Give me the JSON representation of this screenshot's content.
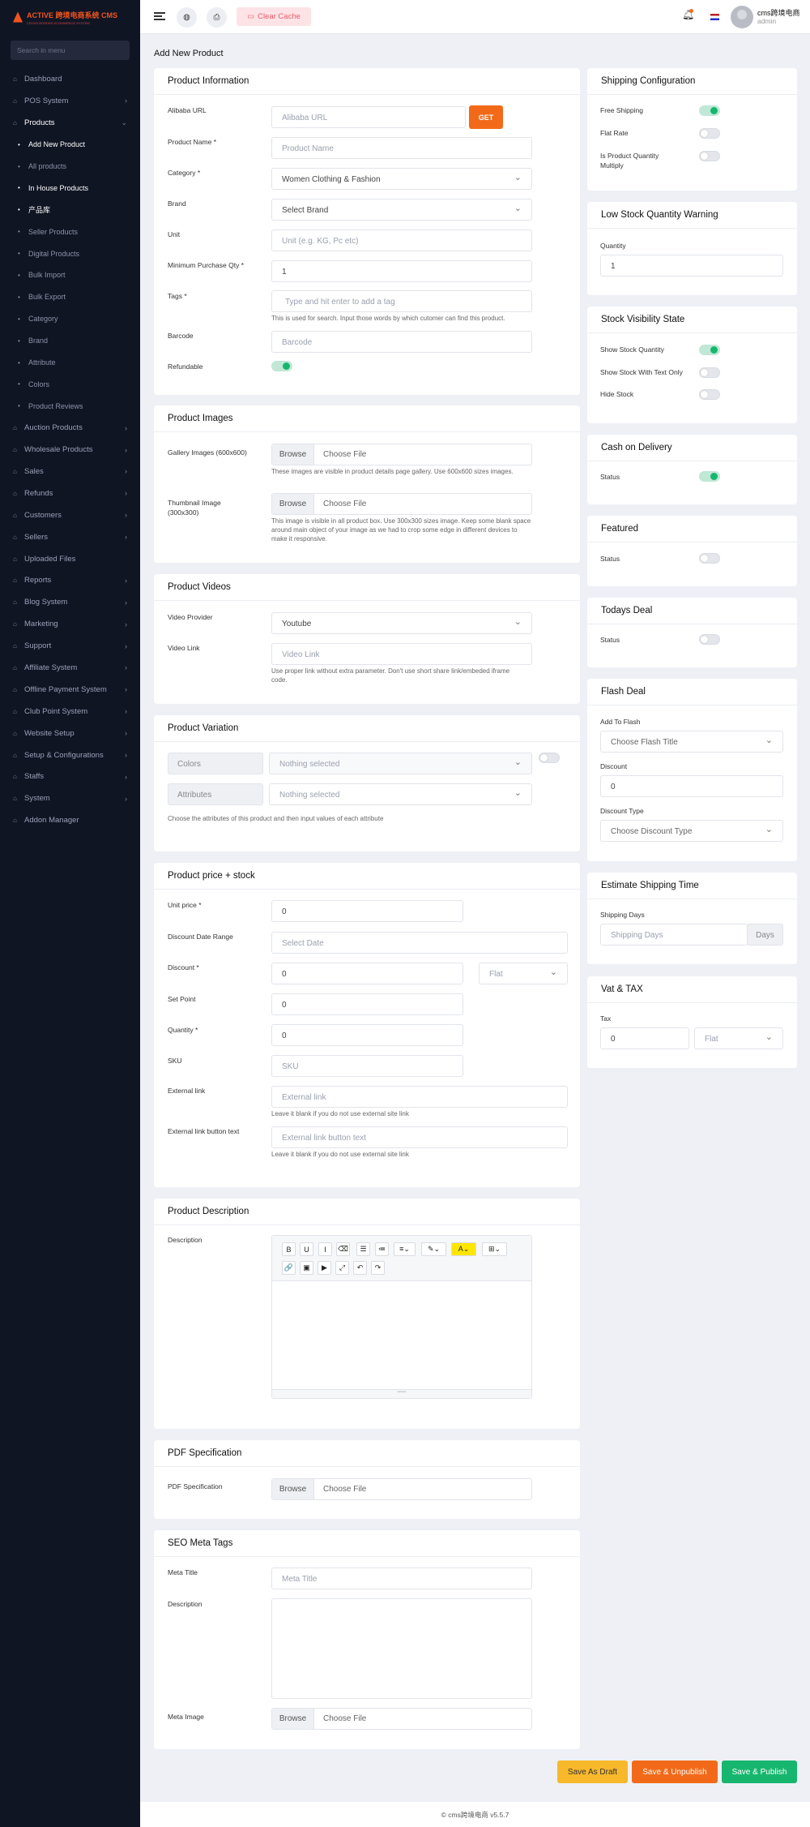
{
  "brand": {
    "name": "ACTIVE 跨境电商系统 CMS",
    "sub": "CROSS BORDER ECOMMERCE SYSTEM"
  },
  "sidebar": {
    "search_placeholder": "Search in menu",
    "items": [
      {
        "label": "Dashboard",
        "icon": "home-icon"
      },
      {
        "label": "POS System",
        "icon": "pos-icon",
        "chev": true
      },
      {
        "label": "Products",
        "icon": "product-icon",
        "chev": true,
        "open": true
      },
      {
        "label": "Add New Product",
        "sub": true,
        "cur": true
      },
      {
        "label": "All products",
        "sub": true
      },
      {
        "label": "In House Products",
        "sub": true,
        "cur": true
      },
      {
        "label": "产品库",
        "sub": true,
        "cur": true
      },
      {
        "label": "Seller Products",
        "sub": true
      },
      {
        "label": "Digital Products",
        "sub": true
      },
      {
        "label": "Bulk Import",
        "sub": true
      },
      {
        "label": "Bulk Export",
        "sub": true
      },
      {
        "label": "Category",
        "sub": true
      },
      {
        "label": "Brand",
        "sub": true
      },
      {
        "label": "Attribute",
        "sub": true
      },
      {
        "label": "Colors",
        "sub": true
      },
      {
        "label": "Product Reviews",
        "sub": true
      },
      {
        "label": "Auction Products",
        "icon": "auction-icon",
        "chev": true
      },
      {
        "label": "Wholesale Products",
        "icon": "wholesale-icon",
        "chev": true
      },
      {
        "label": "Sales",
        "icon": "sales-icon",
        "chev": true
      },
      {
        "label": "Refunds",
        "icon": "refund-icon",
        "chev": true
      },
      {
        "label": "Customers",
        "icon": "customers-icon",
        "chev": true
      },
      {
        "label": "Sellers",
        "icon": "sellers-icon",
        "chev": true
      },
      {
        "label": "Uploaded Files",
        "icon": "files-icon"
      },
      {
        "label": "Reports",
        "icon": "reports-icon",
        "chev": true
      },
      {
        "label": "Blog System",
        "icon": "blog-icon",
        "chev": true
      },
      {
        "label": "Marketing",
        "icon": "marketing-icon",
        "chev": true
      },
      {
        "label": "Support",
        "icon": "support-icon",
        "chev": true
      },
      {
        "label": "Affiliate System",
        "icon": "affiliate-icon",
        "chev": true
      },
      {
        "label": "Offline Payment System",
        "icon": "payment-icon",
        "chev": true
      },
      {
        "label": "Club Point System",
        "icon": "club-icon",
        "chev": true
      },
      {
        "label": "Website Setup",
        "icon": "website-icon",
        "chev": true
      },
      {
        "label": "Setup & Configurations",
        "icon": "setup-icon",
        "chev": true
      },
      {
        "label": "Staffs",
        "icon": "staff-icon",
        "chev": true
      },
      {
        "label": "System",
        "icon": "system-icon",
        "chev": true
      },
      {
        "label": "Addon Manager",
        "icon": "addon-icon"
      }
    ]
  },
  "topbar": {
    "clear_cache": "Clear Cache",
    "user_name": "cms跨境电商",
    "user_role": "admin"
  },
  "page_title": "Add New Product",
  "product_info": {
    "title": "Product Information",
    "alibaba_label": "Alibaba URL",
    "alibaba_ph": "Alibaba URL",
    "get": "GET",
    "name_label": "Product Name *",
    "name_ph": "Product Name",
    "category_label": "Category *",
    "category_val": "Women Clothing & Fashion",
    "brand_label": "Brand",
    "brand_val": "Select Brand",
    "unit_label": "Unit",
    "unit_ph": "Unit (e.g. KG, Pc etc)",
    "minqty_label": "Minimum Purchase Qty *",
    "minqty_val": "1",
    "tags_label": "Tags *",
    "tags_ph": "Type and hit enter to add a tag",
    "tags_help": "This is used for search. Input those words by which cutomer can find this product.",
    "barcode_label": "Barcode",
    "barcode_ph": "Barcode",
    "refundable_label": "Refundable",
    "refundable_on": true
  },
  "images": {
    "title": "Product Images",
    "gallery_label": "Gallery Images (600x600)",
    "browse": "Browse",
    "choose": "Choose File",
    "gallery_help": "These images are visible in product details page gallery. Use 600x600 sizes images.",
    "thumb_label": "Thumbnail Image (300x300)",
    "thumb_help": "This image is visible in all product box. Use 300x300 sizes image. Keep some blank space around main object of your image as we had to crop some edge in different devices to make it responsive."
  },
  "videos": {
    "title": "Product Videos",
    "provider_label": "Video Provider",
    "provider_val": "Youtube",
    "link_label": "Video Link",
    "link_ph": "Video Link",
    "link_help": "Use proper link without extra parameter. Don't use short share link/embeded iframe code."
  },
  "variation": {
    "title": "Product Variation",
    "colors": "Colors",
    "attributes": "Attributes",
    "nothing": "Nothing selected",
    "help": "Choose the attributes of this product and then input values of each attribute"
  },
  "price": {
    "title": "Product price + stock",
    "unit_label": "Unit price *",
    "unit_val": "0",
    "range_label": "Discount Date Range",
    "range_ph": "Select Date",
    "discount_label": "Discount *",
    "discount_val": "0",
    "discount_type": "Flat",
    "setpoint_label": "Set Point",
    "setpoint_val": "0",
    "qty_label": "Quantity *",
    "qty_val": "0",
    "sku_label": "SKU",
    "sku_ph": "SKU",
    "ext_label": "External link",
    "ext_ph": "External link",
    "ext_help": "Leave it blank if you do not use external site link",
    "extbtn_label": "External link button text",
    "extbtn_ph": "External link button text",
    "extbtn_help": "Leave it blank if you do not use external site link"
  },
  "description": {
    "title": "Product Description",
    "label": "Description",
    "toolbar": [
      "B",
      "U",
      "I",
      "⌫",
      "☰",
      "≔",
      "≡⌄",
      "✎⌄",
      "A⌄",
      "⊞⌄",
      "🔗",
      "▣",
      "▶",
      "⤢",
      "↶",
      "↷"
    ]
  },
  "pdf": {
    "title": "PDF Specification",
    "label": "PDF Specification"
  },
  "seo": {
    "title": "SEO Meta Tags",
    "meta_title_label": "Meta Title",
    "meta_title_ph": "Meta Title",
    "desc_label": "Description",
    "image_label": "Meta Image"
  },
  "shipping": {
    "title": "Shipping Configuration",
    "free": "Free Shipping",
    "free_on": true,
    "flat": "Flat Rate",
    "multiply": "Is Product Quantity Multiply"
  },
  "lowstock": {
    "title": "Low Stock Quantity Warning",
    "label": "Quantity",
    "val": "1"
  },
  "visibility": {
    "title": "Stock Visibility State",
    "show_qty": "Show Stock Quantity",
    "show_text": "Show Stock With Text Only",
    "hide": "Hide Stock"
  },
  "cod": {
    "title": "Cash on Delivery",
    "status": "Status"
  },
  "featured": {
    "title": "Featured",
    "status": "Status"
  },
  "todays": {
    "title": "Todays Deal",
    "status": "Status"
  },
  "flash": {
    "title": "Flash Deal",
    "add_label": "Add To Flash",
    "add_val": "Choose Flash Title",
    "discount_label": "Discount",
    "discount_val": "0",
    "type_label": "Discount Type",
    "type_val": "Choose Discount Type"
  },
  "estimate": {
    "title": "Estimate Shipping Time",
    "label": "Shipping Days",
    "ph": "Shipping Days",
    "unit": "Days"
  },
  "vat": {
    "title": "Vat & TAX",
    "label": "Tax",
    "val": "0",
    "type": "Flat"
  },
  "actions": {
    "draft": "Save As Draft",
    "unpublish": "Save & Unpublish",
    "publish": "Save & Publish",
    "draft_color": "#f7b82b",
    "unpublish_color": "#f26a19",
    "publish_color": "#17b66e"
  },
  "footer": "© cms跨境电商 v5.5.7"
}
